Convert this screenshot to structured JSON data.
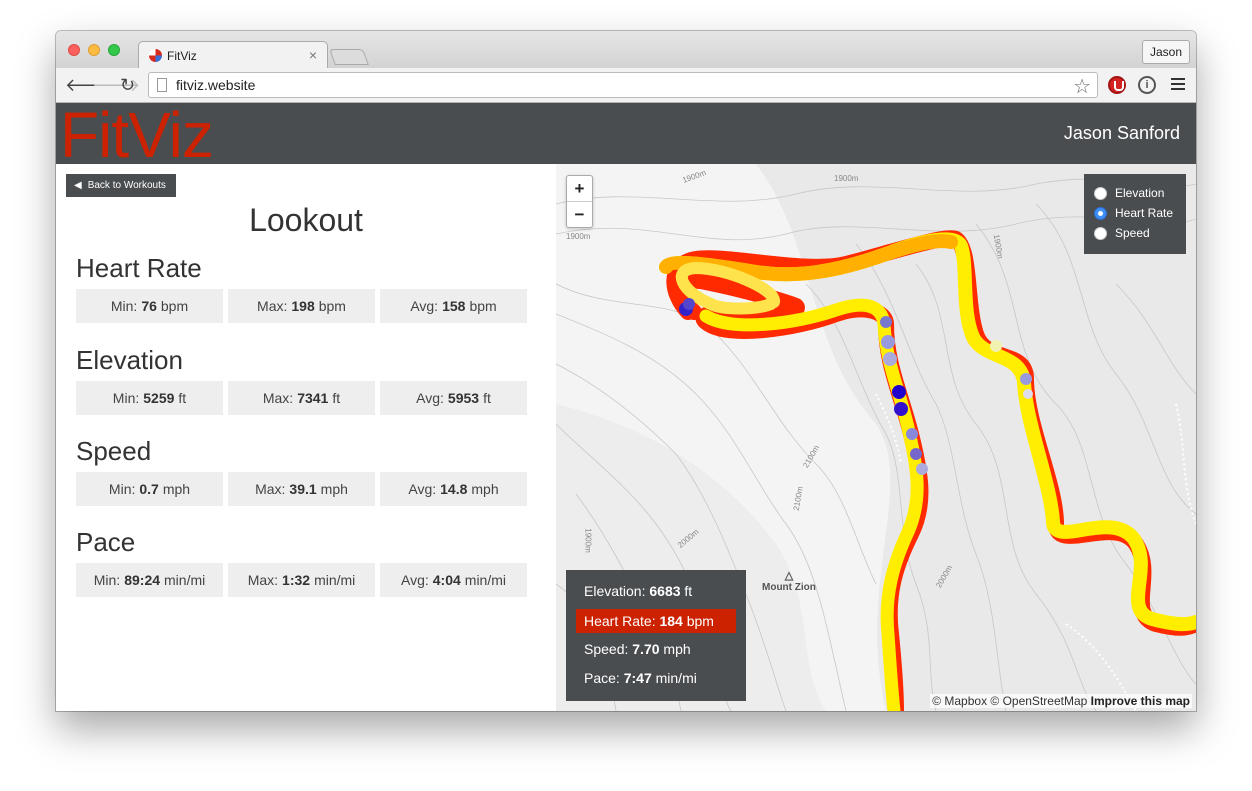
{
  "browser": {
    "tab_title": "FitViz",
    "tab_close": "×",
    "url": "fitviz.website",
    "profile": "Jason",
    "back_glyph": "🡐",
    "forward_glyph": "🡒",
    "reload_glyph": "↻",
    "star_glyph": "☆",
    "info_glyph": "i"
  },
  "header": {
    "logo": "FitViz",
    "user": "Jason Sanford"
  },
  "left": {
    "back_label": "Back to Workouts",
    "back_arrow": "◀",
    "workout_title": "Lookout",
    "metrics": [
      {
        "title": "Heart Rate",
        "stats": [
          {
            "label": "Min:",
            "value": "76",
            "unit": "bpm"
          },
          {
            "label": "Max:",
            "value": "198",
            "unit": "bpm"
          },
          {
            "label": "Avg:",
            "value": "158",
            "unit": "bpm"
          }
        ]
      },
      {
        "title": "Elevation",
        "stats": [
          {
            "label": "Min:",
            "value": "5259",
            "unit": "ft"
          },
          {
            "label": "Max:",
            "value": "7341",
            "unit": "ft"
          },
          {
            "label": "Avg:",
            "value": "5953",
            "unit": "ft"
          }
        ]
      },
      {
        "title": "Speed",
        "stats": [
          {
            "label": "Min:",
            "value": "0.7",
            "unit": "mph"
          },
          {
            "label": "Max:",
            "value": "39.1",
            "unit": "mph"
          },
          {
            "label": "Avg:",
            "value": "14.8",
            "unit": "mph"
          }
        ]
      },
      {
        "title": "Pace",
        "stats": [
          {
            "label": "Min:",
            "value": "89:24",
            "unit": "min/mi"
          },
          {
            "label": "Max:",
            "value": "1:32",
            "unit": "min/mi"
          },
          {
            "label": "Avg:",
            "value": "4:04",
            "unit": "min/mi"
          }
        ]
      }
    ]
  },
  "map": {
    "zoom_in": "+",
    "zoom_out": "−",
    "layers": [
      {
        "label": "Elevation",
        "selected": false
      },
      {
        "label": "Heart Rate",
        "selected": true
      },
      {
        "label": "Speed",
        "selected": false
      }
    ],
    "info": [
      {
        "label": "Elevation:",
        "value": "6683",
        "unit": "ft",
        "highlight": false
      },
      {
        "label": "Heart Rate:",
        "value": "184",
        "unit": "bpm",
        "highlight": true
      },
      {
        "label": "Speed:",
        "value": "7.70",
        "unit": "mph",
        "highlight": false
      },
      {
        "label": "Pace:",
        "value": "7:47",
        "unit": "min/mi",
        "highlight": false
      }
    ],
    "peak_label": "Mount Zion",
    "peak_glyph": "△",
    "contour_labels": [
      "1900m",
      "1900m",
      "1900m",
      "1900m",
      "2100m",
      "2100m",
      "2000m",
      "2000m",
      "1900m"
    ],
    "attribution_prefix": "© Mapbox © OpenStreetMap",
    "attribution_link": "Improve this map"
  },
  "colors": {
    "accent": "#cc2200",
    "header_bg": "#4a4d50",
    "track_high": "#ff0000",
    "track_mid": "#ffff00",
    "track_low": "#3300cc"
  }
}
